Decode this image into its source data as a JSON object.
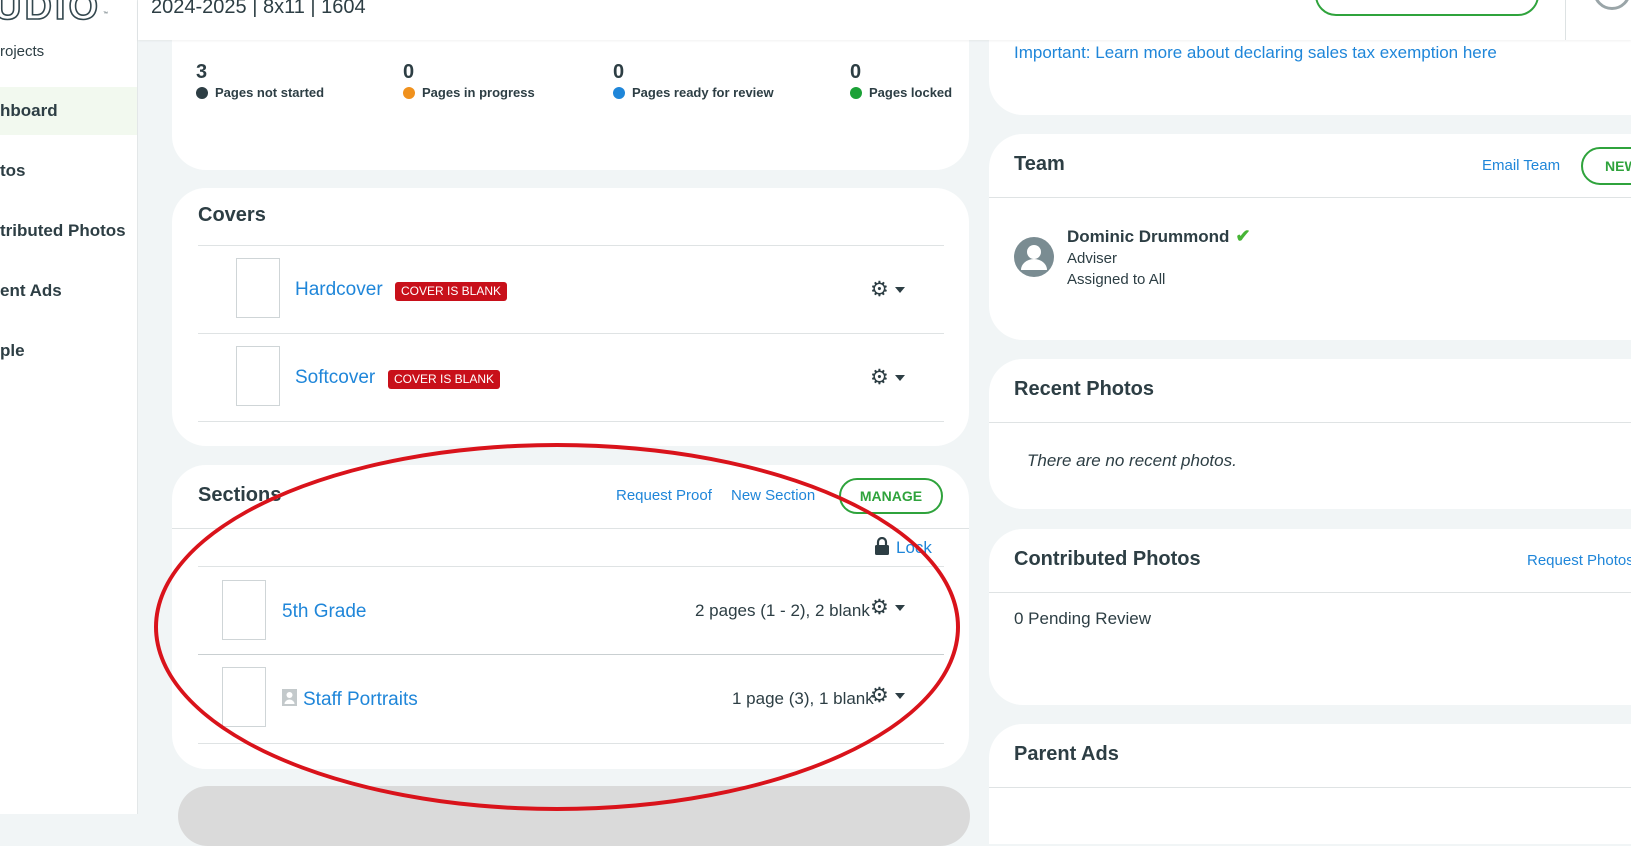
{
  "sidebar": {
    "logo": "UDIO",
    "logo_tm": "™",
    "projects_label": "rojects",
    "items": [
      {
        "label": "hboard",
        "active": true
      },
      {
        "label": "tos",
        "active": false
      },
      {
        "label": "tributed Photos",
        "active": false
      },
      {
        "label": "ent Ads",
        "active": false
      },
      {
        "label": "ple",
        "active": false
      }
    ]
  },
  "header": {
    "project_info": "2024-2025 | 8x11 | 1604"
  },
  "progress": {
    "stats": [
      {
        "count": "3",
        "label": "Pages not started",
        "color": "#2d3e44"
      },
      {
        "count": "0",
        "label": "Pages in progress",
        "color": "#f0911d"
      },
      {
        "count": "0",
        "label": "Pages ready for review",
        "color": "#1f86d9"
      },
      {
        "count": "0",
        "label": "Pages locked",
        "color": "#1ba137"
      }
    ]
  },
  "covers": {
    "title": "Covers",
    "items": [
      {
        "name": "Hardcover",
        "badge": "COVER IS BLANK"
      },
      {
        "name": "Softcover",
        "badge": "COVER IS BLANK"
      }
    ]
  },
  "sections": {
    "title": "Sections",
    "request_proof": "Request Proof",
    "new_section": "New Section",
    "manage": "MANAGE",
    "lock": "Lock",
    "items": [
      {
        "name": "5th Grade",
        "meta": "2 pages (1 - 2), 2 blank",
        "portrait_icon": false
      },
      {
        "name": "Staff Portraits",
        "meta": "1 page (3), 1 blank",
        "portrait_icon": true
      }
    ]
  },
  "tax_notice": {
    "link": "Important: Learn more about declaring sales tax exemption here"
  },
  "team": {
    "title": "Team",
    "email_team": "Email Team",
    "new_label": "NEW",
    "members": [
      {
        "name": "Dominic Drummond",
        "role": "Adviser",
        "assignment": "Assigned to All",
        "verified": true
      }
    ]
  },
  "recent_photos": {
    "title": "Recent Photos",
    "empty": "There are no recent photos."
  },
  "contributed_photos": {
    "title": "Contributed Photos",
    "request_photos": "Request Photos",
    "pending": "0 Pending Review"
  },
  "parent_ads": {
    "title": "Parent Ads"
  },
  "colors": {
    "accent_green": "#2fa33c",
    "link_blue": "#1f86d9",
    "badge_red": "#c8101a",
    "annotation_red": "#d9131b"
  }
}
